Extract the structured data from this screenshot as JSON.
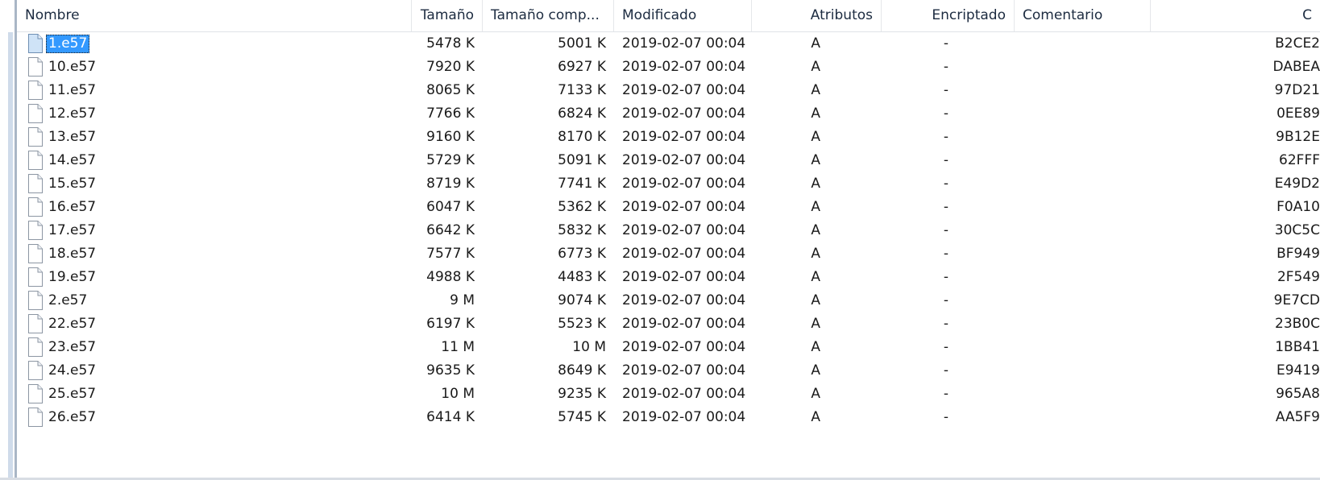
{
  "columns": {
    "name": "Nombre",
    "size": "Tamaño",
    "packed": "Tamaño comp...",
    "modified": "Modificado",
    "attributes": "Atributos",
    "encrypted": "Encriptado",
    "comment": "Comentario",
    "crc": "C"
  },
  "colors": {
    "selection": "#3399ff",
    "header_text": "#1c2b40"
  },
  "files": [
    {
      "name": "1.e57",
      "size": "5478 K",
      "packed": "5001 K",
      "modified": "2019-02-07 00:04",
      "attr": "A",
      "enc": "-",
      "comment": "",
      "crc": "B2CE2",
      "selected": true
    },
    {
      "name": "10.e57",
      "size": "7920 K",
      "packed": "6927 K",
      "modified": "2019-02-07 00:04",
      "attr": "A",
      "enc": "-",
      "comment": "",
      "crc": "DABEA"
    },
    {
      "name": "11.e57",
      "size": "8065 K",
      "packed": "7133 K",
      "modified": "2019-02-07 00:04",
      "attr": "A",
      "enc": "-",
      "comment": "",
      "crc": "97D21"
    },
    {
      "name": "12.e57",
      "size": "7766 K",
      "packed": "6824 K",
      "modified": "2019-02-07 00:04",
      "attr": "A",
      "enc": "-",
      "comment": "",
      "crc": "0EE89"
    },
    {
      "name": "13.e57",
      "size": "9160 K",
      "packed": "8170 K",
      "modified": "2019-02-07 00:04",
      "attr": "A",
      "enc": "-",
      "comment": "",
      "crc": "9B12E"
    },
    {
      "name": "14.e57",
      "size": "5729 K",
      "packed": "5091 K",
      "modified": "2019-02-07 00:04",
      "attr": "A",
      "enc": "-",
      "comment": "",
      "crc": "62FFF"
    },
    {
      "name": "15.e57",
      "size": "8719 K",
      "packed": "7741 K",
      "modified": "2019-02-07 00:04",
      "attr": "A",
      "enc": "-",
      "comment": "",
      "crc": "E49D2"
    },
    {
      "name": "16.e57",
      "size": "6047 K",
      "packed": "5362 K",
      "modified": "2019-02-07 00:04",
      "attr": "A",
      "enc": "-",
      "comment": "",
      "crc": "F0A10"
    },
    {
      "name": "17.e57",
      "size": "6642 K",
      "packed": "5832 K",
      "modified": "2019-02-07 00:04",
      "attr": "A",
      "enc": "-",
      "comment": "",
      "crc": "30C5C"
    },
    {
      "name": "18.e57",
      "size": "7577 K",
      "packed": "6773 K",
      "modified": "2019-02-07 00:04",
      "attr": "A",
      "enc": "-",
      "comment": "",
      "crc": "BF949"
    },
    {
      "name": "19.e57",
      "size": "4988 K",
      "packed": "4483 K",
      "modified": "2019-02-07 00:04",
      "attr": "A",
      "enc": "-",
      "comment": "",
      "crc": "2F549"
    },
    {
      "name": "2.e57",
      "size": "9 M",
      "packed": "9074 K",
      "modified": "2019-02-07 00:04",
      "attr": "A",
      "enc": "-",
      "comment": "",
      "crc": "9E7CD"
    },
    {
      "name": "22.e57",
      "size": "6197 K",
      "packed": "5523 K",
      "modified": "2019-02-07 00:04",
      "attr": "A",
      "enc": "-",
      "comment": "",
      "crc": "23B0C"
    },
    {
      "name": "23.e57",
      "size": "11 M",
      "packed": "10 M",
      "modified": "2019-02-07 00:04",
      "attr": "A",
      "enc": "-",
      "comment": "",
      "crc": "1BB41"
    },
    {
      "name": "24.e57",
      "size": "9635 K",
      "packed": "8649 K",
      "modified": "2019-02-07 00:04",
      "attr": "A",
      "enc": "-",
      "comment": "",
      "crc": "E9419"
    },
    {
      "name": "25.e57",
      "size": "10 M",
      "packed": "9235 K",
      "modified": "2019-02-07 00:04",
      "attr": "A",
      "enc": "-",
      "comment": "",
      "crc": "965A8"
    },
    {
      "name": "26.e57",
      "size": "6414 K",
      "packed": "5745 K",
      "modified": "2019-02-07 00:04",
      "attr": "A",
      "enc": "-",
      "comment": "",
      "crc": "AA5F9"
    }
  ]
}
